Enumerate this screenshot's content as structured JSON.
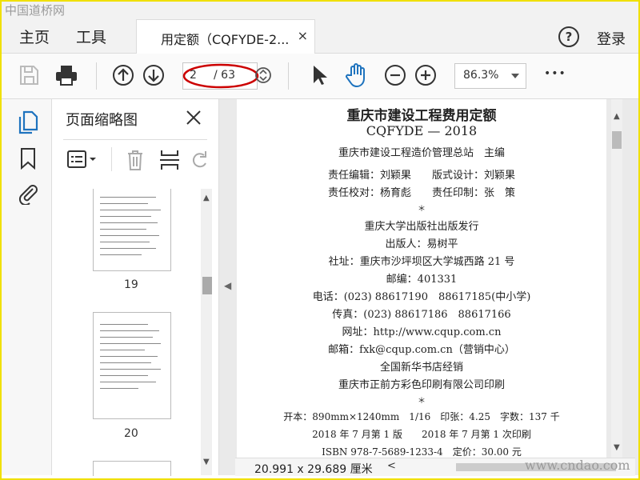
{
  "watermark_top": "中国道桥网",
  "watermark_bottom": "www.cndao.com",
  "menu": {
    "home": "主页",
    "tools": "工具",
    "login": "登录"
  },
  "tab": {
    "title": "用定额（CQFYDE-2...",
    "close": "×"
  },
  "toolbar": {
    "page_current": "2",
    "page_total": "/ 63",
    "zoom": "86.3%",
    "more": "•••"
  },
  "sidebar": {
    "panel_title": "页面缩略图",
    "thumbs": [
      {
        "label": "19"
      },
      {
        "label": "20"
      }
    ]
  },
  "document": {
    "lines": [
      "重庆市建设工程费用定额",
      "CQFYDE — 2018",
      "重庆市建设工程造价管理总站　主编",
      "责任编辑：刘颖果　　版式设计：刘颖果",
      "责任校对：杨育彪　　责任印制：张　策",
      "＊",
      "重庆大学出版社出版发行",
      "出版人：易树平",
      "社址：重庆市沙坪坝区大学城西路 21 号",
      "邮编：401331",
      "电话：(023) 88617190　88617185(中小学)",
      "传真：(023) 88617186　88617166",
      "网址：http://www.cqup.com.cn",
      "邮箱：fxk@cqup.com.cn（营销中心）",
      "全国新华书店经销",
      "重庆市正前方彩色印刷有限公司印刷",
      "＊",
      "开本：890mm×1240mm　1/16　印张：4.25　字数：137 千",
      "2018 年 7 月第 1 版　　2018 年 7 月第 1 次印刷",
      "ISBN 978-7-5689-1233-4　定价：30.00 元"
    ]
  },
  "statusbar": {
    "dimensions": "20.991 x 29.689 厘米"
  },
  "colors": {
    "accent": "#1e73be",
    "annotation": "#cc0000",
    "frame": "#f0e000"
  }
}
